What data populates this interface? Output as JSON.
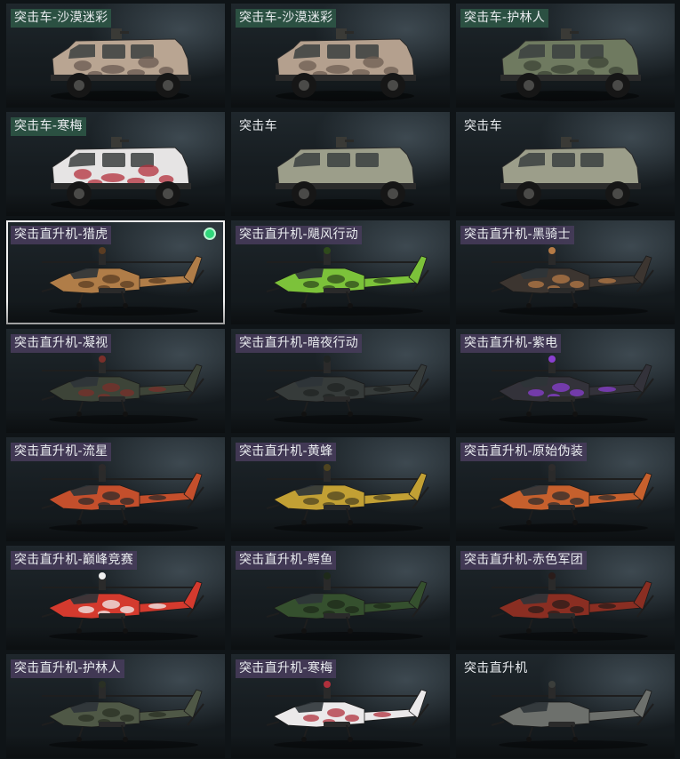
{
  "cards": [
    {
      "label": "突击车-沙漠迷彩",
      "kind": "truck",
      "tag": "veh",
      "body": "#b9a592",
      "accent": "#6a5a50",
      "camo": true
    },
    {
      "label": "突击车-沙漠迷彩",
      "kind": "truck",
      "tag": "veh",
      "body": "#b4a08e",
      "accent": "#6e5d52",
      "camo": true
    },
    {
      "label": "突击车-护林人",
      "kind": "truck",
      "tag": "veh",
      "body": "#6f7a60",
      "accent": "#3c4436",
      "camo": true
    },
    {
      "label": "突击车-寒梅",
      "kind": "truck",
      "tag": "veh",
      "body": "#e6e4e4",
      "accent": "#b3303c",
      "camo": true
    },
    {
      "label": "突击车",
      "kind": "truck",
      "tag": "plain",
      "body": "#9c9e8a",
      "accent": "#5d6052",
      "camo": false
    },
    {
      "label": "突击车",
      "kind": "truck",
      "tag": "plain",
      "body": "#9c9e8a",
      "accent": "#5d6052",
      "camo": false
    },
    {
      "label": "突击直升机-猎虎",
      "kind": "heli",
      "tag": "heli",
      "body": "#b07d48",
      "accent": "#5a3c22",
      "camo": true,
      "selected": true
    },
    {
      "label": "突击直升机-飓风行动",
      "kind": "heli",
      "tag": "heli",
      "body": "#7cc23a",
      "accent": "#2f4a1c",
      "camo": true
    },
    {
      "label": "突击直升机-黑骑士",
      "kind": "heli",
      "tag": "heli",
      "body": "#3c3530",
      "accent": "#b57a45",
      "camo": true
    },
    {
      "label": "突击直升机-凝视",
      "kind": "heli",
      "tag": "heli",
      "body": "#3d4438",
      "accent": "#7a2f2a",
      "camo": true
    },
    {
      "label": "突击直升机-暗夜行动",
      "kind": "heli",
      "tag": "heli",
      "body": "#363b3a",
      "accent": "#202423",
      "camo": true
    },
    {
      "label": "突击直升机-紫电",
      "kind": "heli",
      "tag": "heli",
      "body": "#33323a",
      "accent": "#8a3fd0",
      "camo": true
    },
    {
      "label": "突击直升机-流星",
      "kind": "heli",
      "tag": "heli",
      "body": "#c44f2c",
      "accent": "#2d2a2a",
      "camo": true
    },
    {
      "label": "突击直升机-黄蜂",
      "kind": "heli",
      "tag": "heli",
      "body": "#c2a034",
      "accent": "#4e4420",
      "camo": true
    },
    {
      "label": "突击直升机-原始伪装",
      "kind": "heli",
      "tag": "heli",
      "body": "#c6602d",
      "accent": "#2e2c2c",
      "camo": true
    },
    {
      "label": "突击直升机-巅峰竞赛",
      "kind": "heli",
      "tag": "heli",
      "body": "#d43a2e",
      "accent": "#f0f0f0",
      "camo": true
    },
    {
      "label": "突击直升机-鳄鱼",
      "kind": "heli",
      "tag": "heli",
      "body": "#35502e",
      "accent": "#1e2a1a",
      "camo": true
    },
    {
      "label": "突击直升机-赤色军团",
      "kind": "heli",
      "tag": "heli",
      "body": "#8a2e22",
      "accent": "#2a1c1a",
      "camo": true
    },
    {
      "label": "突击直升机-护林人",
      "kind": "heli",
      "tag": "heli",
      "body": "#4f5846",
      "accent": "#2a3024",
      "camo": true
    },
    {
      "label": "突击直升机-寒梅",
      "kind": "heli",
      "tag": "heli",
      "body": "#ebe9ea",
      "accent": "#b0303c",
      "camo": true
    },
    {
      "label": "突击直升机",
      "kind": "heli",
      "tag": "plain",
      "body": "#6d706c",
      "accent": "#3b3e3b",
      "camo": false
    }
  ],
  "selection_indicator_color": "#2fd67a"
}
